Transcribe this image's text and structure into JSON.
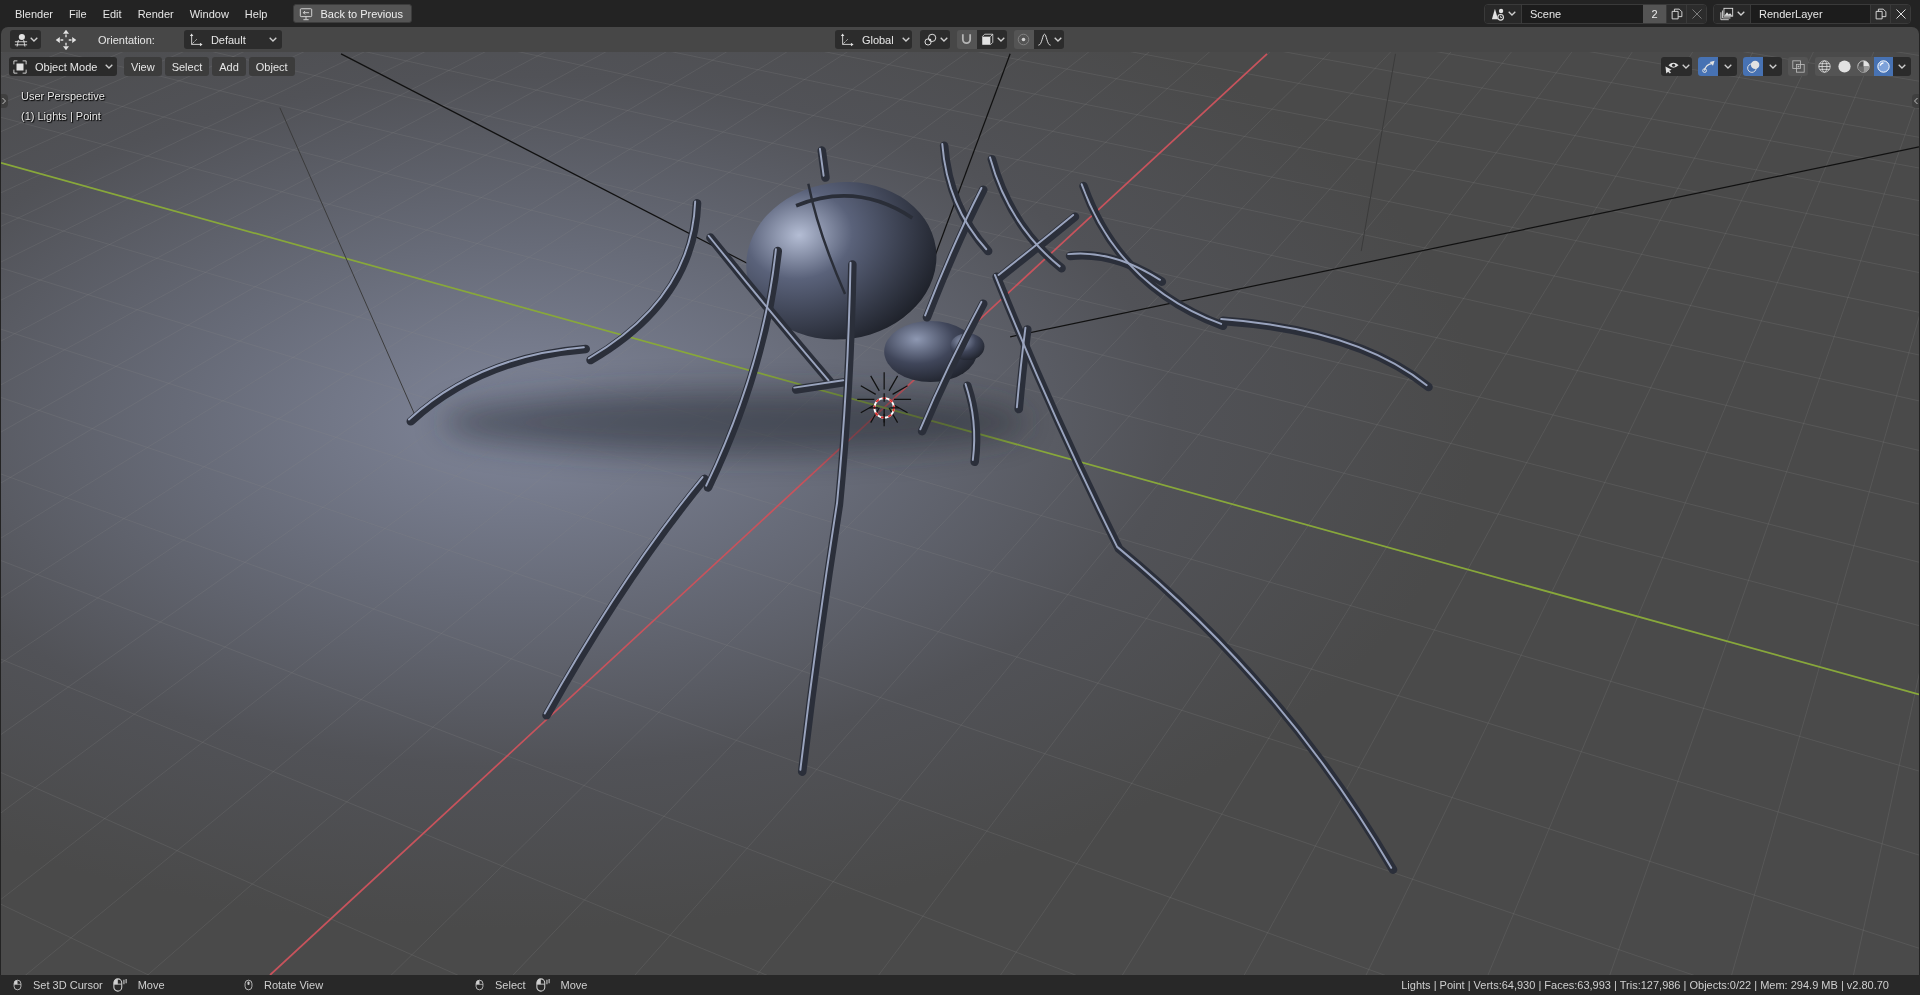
{
  "menu_bar": {
    "items": [
      "Blender",
      "File",
      "Edit",
      "Render",
      "Window",
      "Help"
    ],
    "back_button": "Back to Previous"
  },
  "scene_selector": {
    "name": "Scene",
    "users": "2"
  },
  "view_layer_selector": {
    "name": "RenderLayer"
  },
  "tool_header": {
    "orientation_label": "Orientation:",
    "orientation": "Default",
    "transform_orientation": "Global",
    "snap_on": false,
    "proportional_editing_on": false
  },
  "viewport_header": {
    "mode": "Object Mode",
    "menus": [
      "View",
      "Select",
      "Add",
      "Object"
    ],
    "gizmos_on": true,
    "overlays_on": true,
    "xray_on": false,
    "shading_modes": [
      {
        "kind": "wireframe",
        "selected": false
      },
      {
        "kind": "solid",
        "selected": false
      },
      {
        "kind": "material",
        "selected": false
      },
      {
        "kind": "rendered",
        "selected": true
      }
    ]
  },
  "viewport": {
    "view_name": "User Perspective",
    "active_object": "(1) Lights | Point"
  },
  "status_bar": {
    "hint_groups": [
      {
        "hints": [
          {
            "kind": "mouse_left",
            "label": "Set 3D Cursor"
          },
          {
            "kind": "mouse_drag",
            "label": "Move"
          }
        ]
      },
      {
        "hints": [
          {
            "kind": "mouse_middle",
            "label": "Rotate View"
          }
        ]
      },
      {
        "hints": [
          {
            "kind": "mouse_left",
            "label": "Select"
          },
          {
            "kind": "mouse_drag",
            "label": "Move"
          }
        ]
      }
    ],
    "stats": "Lights | Point | Verts:64,930 | Faces:63,993 | Tris:127,986 | Objects:0/22 | Mem: 294.9 MB | v2.80.70"
  }
}
